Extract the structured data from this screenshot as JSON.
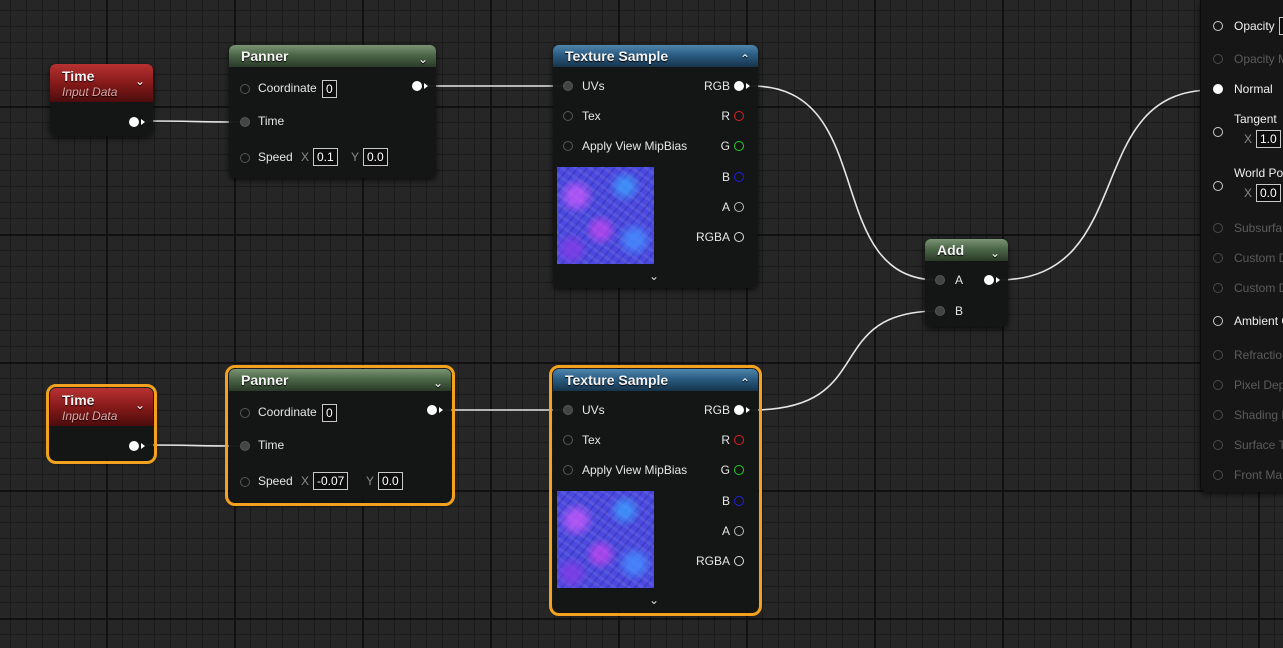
{
  "nodes": {
    "time1": {
      "title": "Time",
      "subtitle": "Input Data"
    },
    "time2": {
      "title": "Time",
      "subtitle": "Input Data"
    },
    "panner1": {
      "title": "Panner",
      "coordinate_label": "Coordinate",
      "coordinate_value": "0",
      "time_label": "Time",
      "speed_label": "Speed",
      "x_label": "X",
      "speed_x": "0.1",
      "y_label": "Y",
      "speed_y": "0.0"
    },
    "panner2": {
      "title": "Panner",
      "coordinate_label": "Coordinate",
      "coordinate_value": "0",
      "time_label": "Time",
      "speed_label": "Speed",
      "x_label": "X",
      "speed_x": "-0.07",
      "y_label": "Y",
      "speed_y": "0.0"
    },
    "texture1": {
      "title": "Texture Sample",
      "inputs": [
        "UVs",
        "Tex",
        "Apply View MipBias"
      ],
      "outputs": [
        "RGB",
        "R",
        "G",
        "B",
        "A",
        "RGBA"
      ]
    },
    "texture2": {
      "title": "Texture Sample",
      "inputs": [
        "UVs",
        "Tex",
        "Apply View MipBias"
      ],
      "outputs": [
        "RGB",
        "R",
        "G",
        "B",
        "A",
        "RGBA"
      ]
    },
    "add": {
      "title": "Add",
      "input_a": "A",
      "input_b": "B"
    }
  },
  "material_panel": {
    "items": [
      {
        "label": "Opacity",
        "active": true
      },
      {
        "label": "Opacity M",
        "active": false
      },
      {
        "label": "Normal",
        "active": true,
        "connected": true
      },
      {
        "label": "Tangent",
        "active": true,
        "x_label": "X",
        "value": "1.0"
      },
      {
        "label": "World Po",
        "active": true,
        "x_label": "X",
        "value": "0.0"
      },
      {
        "label": "Subsurfa",
        "active": false
      },
      {
        "label": "Custom D",
        "active": false
      },
      {
        "label": "Custom D",
        "active": false
      },
      {
        "label": "Ambient C",
        "active": true
      },
      {
        "label": "Refractio",
        "active": false
      },
      {
        "label": "Pixel Dep",
        "active": false
      },
      {
        "label": "Shading M",
        "active": false
      },
      {
        "label": "Surface T",
        "active": false
      },
      {
        "label": "Front Ma",
        "active": false
      }
    ]
  },
  "icons": {
    "collapse": "chevron-down-icon",
    "expand": "chevron-up-icon",
    "pin": "pin-circle-icon"
  },
  "colors": {
    "selection": "#f2a21f",
    "r_channel": "#e02020",
    "g_channel": "#20d020",
    "b_channel": "#2020e0",
    "a_channel": "#bbbbbb",
    "wire": "#e6e6e6"
  }
}
